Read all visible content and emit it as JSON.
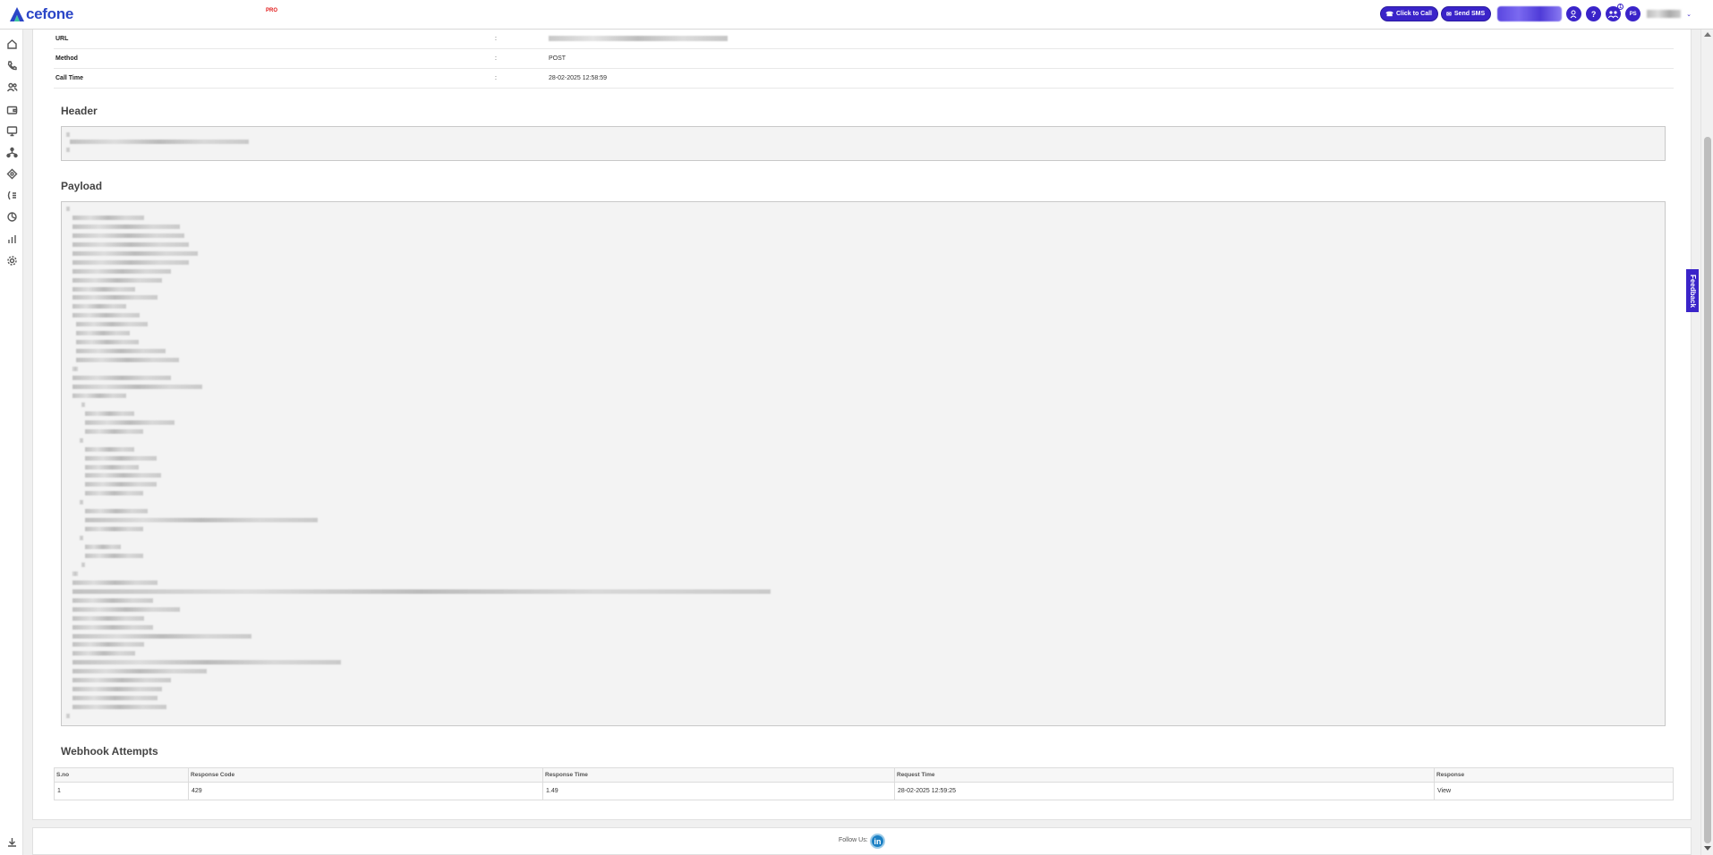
{
  "header": {
    "brand": "cefone",
    "beta_tag": "PRO",
    "click_to_call": "Click to Call",
    "send_sms": "Send SMS",
    "help": "?",
    "avatar_initials": "PS",
    "notification_badge": "1"
  },
  "details": {
    "url_label": "URL",
    "method_label": "Method",
    "method_value": "POST",
    "call_time_label": "Call Time",
    "call_time_value": "28-02-2025 12:58:59",
    "separator": ":"
  },
  "sections": {
    "header_title": "Header",
    "payload_title": "Payload",
    "attempts_title": "Webhook Attempts"
  },
  "attempts_table": {
    "columns": [
      "S.no",
      "Response Code",
      "Response Time",
      "Request Time",
      "Response"
    ],
    "rows": [
      [
        "1",
        "429",
        "1.49",
        "28-02-2025 12:59:25",
        "View"
      ]
    ]
  },
  "footer": {
    "follow_us": "Follow Us:",
    "linkedin": "in"
  },
  "feedback_tab": "Feedback",
  "sidebar_icons": [
    "home-icon",
    "phone-icon",
    "contacts-icon",
    "wallet-icon",
    "monitor-icon",
    "network-icon",
    "integrations-icon",
    "ivr-icon",
    "analytics-icon",
    "reports-icon",
    "settings-icon",
    "download-icon"
  ]
}
